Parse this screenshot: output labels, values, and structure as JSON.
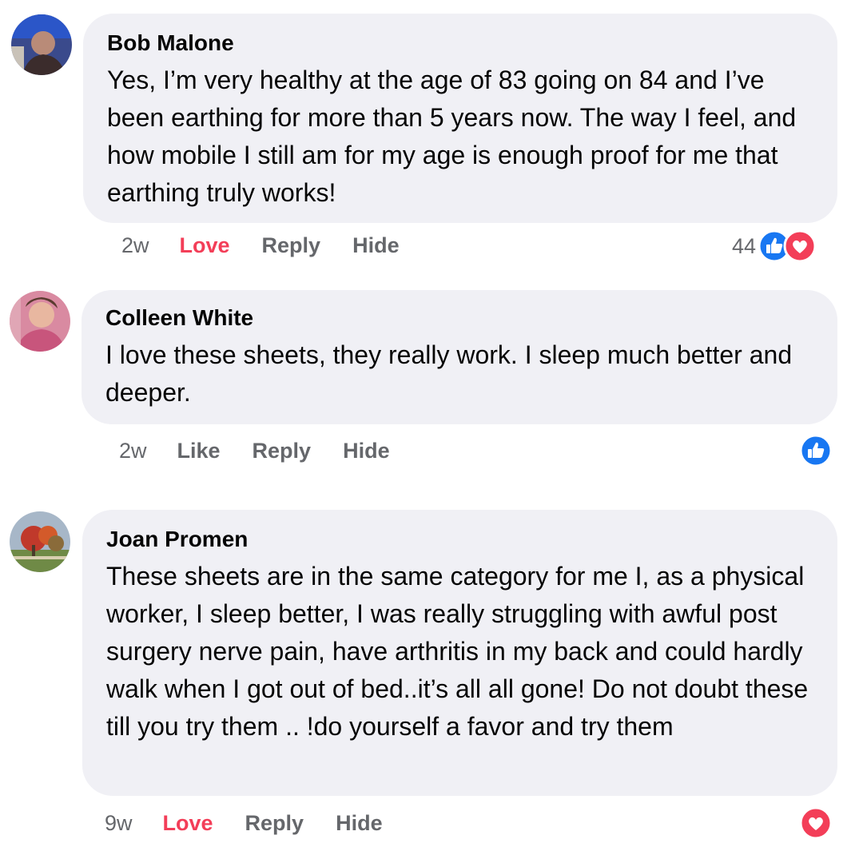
{
  "comments": [
    {
      "author": "Bob Malone",
      "text": "Yes, I’m very healthy at the age of 83 going on 84 and I’ve been earthing for more than 5 years now. The way I feel, and how mobile I still am for my age is enough proof for me that earthing truly works!",
      "time": "2w",
      "reaction_label": "Love",
      "reply_label": "Reply",
      "hide_label": "Hide",
      "reaction_count": "44",
      "reaction_icons": [
        "like-icon",
        "love-icon"
      ]
    },
    {
      "author": "Colleen White",
      "text": "I love these sheets, they really work. I sleep much better and deeper.",
      "time": "2w",
      "reaction_label": "Like",
      "reply_label": "Reply",
      "hide_label": "Hide",
      "reaction_count": "",
      "reaction_icons": [
        "like-icon"
      ]
    },
    {
      "author": "Joan Promen",
      "text": "These sheets are in the same category for me I, as a physical worker, I sleep better, I was really struggling with awful post surgery nerve pain, have arthritis in my back and could hardly walk when I got out of bed..it’s all all gone! Do not doubt these till you try them .. !do yourself a favor and try them",
      "time": "9w",
      "reaction_label": "Love",
      "reply_label": "Reply",
      "hide_label": "Hide",
      "reaction_count": "",
      "reaction_icons": [
        "love-icon"
      ]
    }
  ],
  "colors": {
    "bubble": "#f0f0f5",
    "love": "#f33e58",
    "like": "#1877f2",
    "meta": "#65676b"
  }
}
